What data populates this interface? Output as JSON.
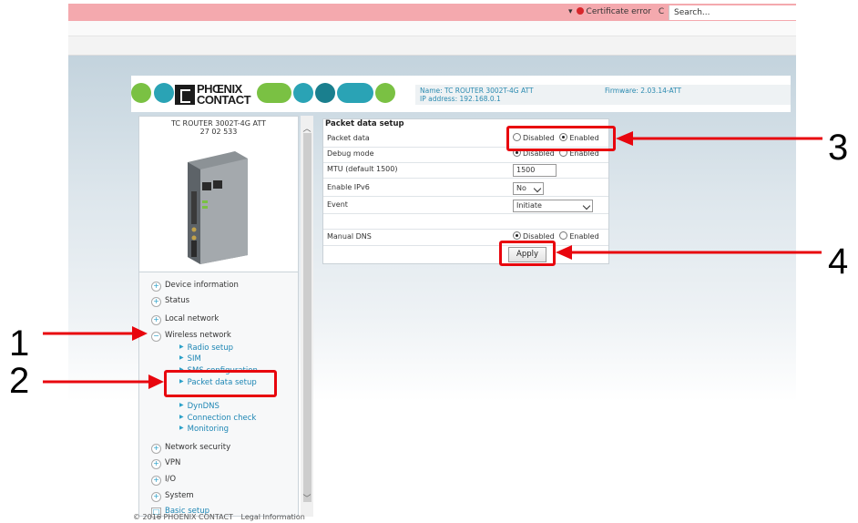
{
  "browser": {
    "dropdown_glyph": "▾",
    "cert_error": "Certificate error",
    "refresh_glyph": "C",
    "search_placeholder": "Search..."
  },
  "header": {
    "logo_line1": "PHŒNIX",
    "logo_line2": "CONTACT",
    "name_line": "Name: TC ROUTER 3002T-4G ATT",
    "ip_line": "IP address: 192.168.0.1",
    "firmware": "Firmware: 2.03.14-ATT",
    "colors": {
      "green": "#7ac143",
      "teal": "#2aa3b5",
      "dark_teal": "#1a7f8e"
    }
  },
  "device": {
    "model": "TC ROUTER 3002T-4G ATT",
    "article": "27 02 533"
  },
  "nav": {
    "items": [
      {
        "label": "Device information",
        "state": "+"
      },
      {
        "label": "Status",
        "state": "+"
      },
      {
        "label": "Local network",
        "state": "+"
      },
      {
        "label": "Wireless network",
        "state": "−"
      },
      {
        "label": "Network security",
        "state": "+"
      },
      {
        "label": "VPN",
        "state": "+"
      },
      {
        "label": "I/O",
        "state": "+"
      },
      {
        "label": "System",
        "state": "+"
      },
      {
        "label": "Basic setup",
        "state": "□"
      }
    ],
    "subitems": [
      "Radio setup",
      "SIM",
      "SMS configuration",
      "Packet data setup",
      "DynDNS",
      "Connection check",
      "Monitoring"
    ]
  },
  "form": {
    "title": "Packet data setup",
    "rows": {
      "packet_data": "Packet data",
      "debug_mode": "Debug mode",
      "mtu": "MTU (default 1500)",
      "ipv6": "Enable IPv6",
      "event": "Event",
      "manual_dns": "Manual DNS"
    },
    "disabled": "Disabled",
    "enabled": "Enabled",
    "mtu_value": "1500",
    "ipv6_value": "No",
    "event_value": "Initiate",
    "apply": "Apply"
  },
  "footer": {
    "copyright": "© 2016 PHOENIX CONTACT",
    "legal": "Legal Information"
  },
  "annotations": {
    "color": "#e8060e",
    "labels": [
      "1",
      "2",
      "3",
      "4"
    ]
  }
}
